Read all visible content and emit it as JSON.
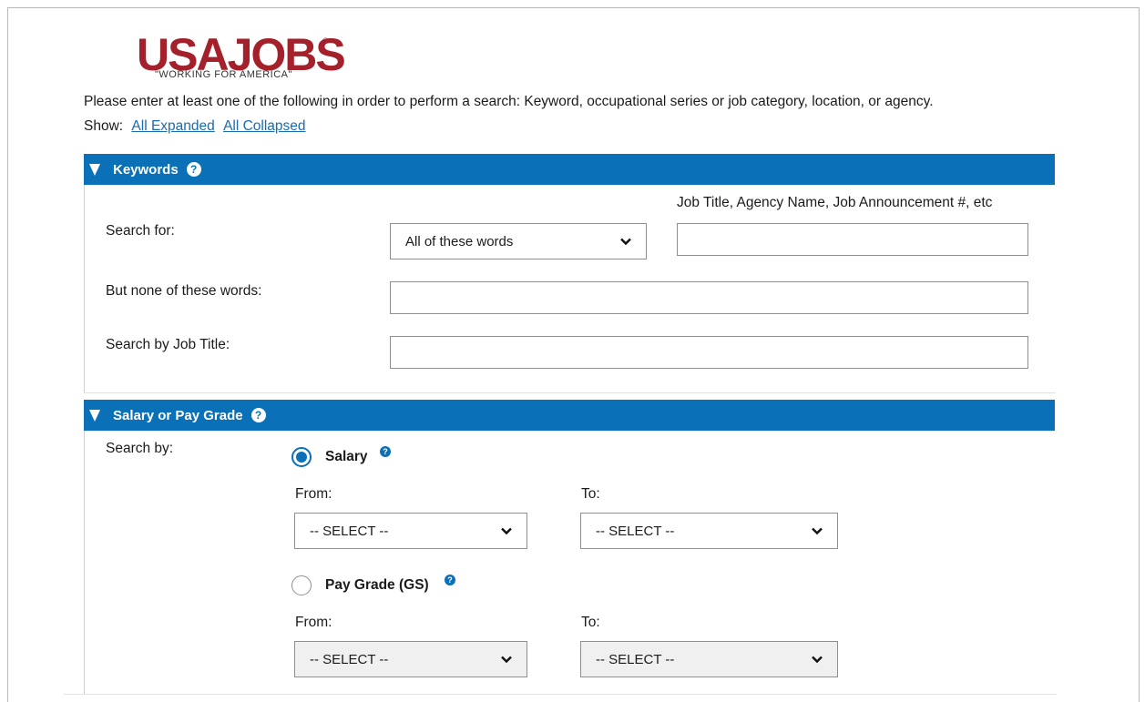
{
  "logo": {
    "word": "USAJOBS",
    "tagline": "\"WORKING FOR AMERICA\"",
    "reg_mark": "®"
  },
  "intro_text": "Please enter at least one of the following in order to perform a search: Keyword, occupational series or job category, location, or agency.",
  "show": {
    "label": "Show:",
    "expanded": "All Expanded",
    "collapsed": "All Collapsed"
  },
  "keywords": {
    "header": "Keywords",
    "help_glyph": "?",
    "hint": "Job Title, Agency Name, Job Announcement #, etc",
    "search_for_label": "Search for:",
    "search_mode": {
      "selected": "All of these words"
    },
    "search_for_value": "",
    "none_label": "But none of these words:",
    "none_value": "",
    "job_title_label": "Search by Job Title:",
    "job_title_value": ""
  },
  "salary": {
    "header": "Salary or Pay Grade",
    "help_glyph": "?",
    "search_by_label": "Search by:",
    "salary_option": {
      "label": "Salary",
      "selected": true
    },
    "salary_from_label": "From:",
    "salary_to_label": "To:",
    "salary_from": "-- SELECT --",
    "salary_to": "-- SELECT --",
    "grade_option": {
      "label": "Pay Grade (GS)",
      "selected": false
    },
    "grade_from_label": "From:",
    "grade_to_label": "To:",
    "grade_from": "-- SELECT --",
    "grade_to": "-- SELECT --"
  },
  "colors": {
    "header_blue": "#0a70b8",
    "logo_red": "#a4212c",
    "link_blue": "#1a6bb0"
  }
}
